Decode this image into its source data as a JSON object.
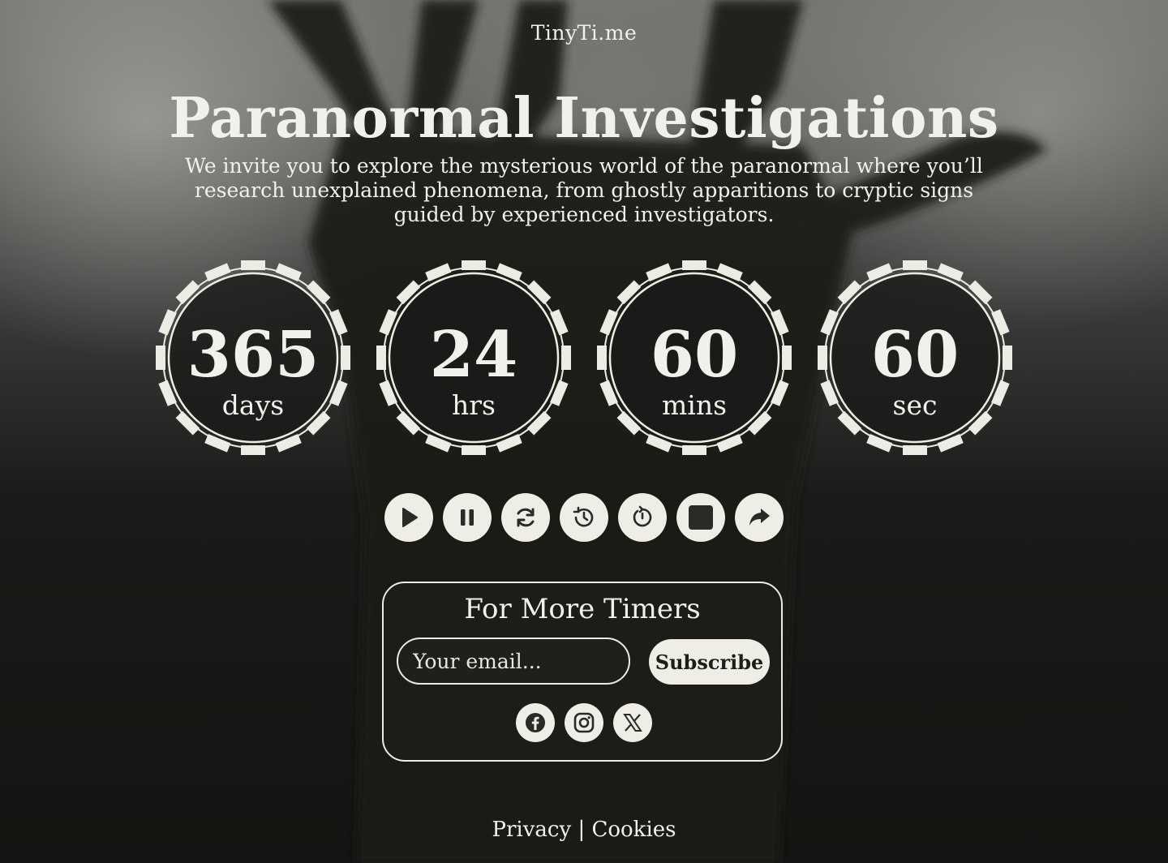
{
  "brand": "TinyTi.me",
  "title": "Paranormal Investigations",
  "subtitle": "We invite you to explore the mysterious world of the paranormal where you’ll research unexplained phenomena, from ghostly apparitions to cryptic signs guided by experienced investigators.",
  "counters": [
    {
      "value": "365",
      "unit": "days"
    },
    {
      "value": "24",
      "unit": "hrs"
    },
    {
      "value": "60",
      "unit": "mins"
    },
    {
      "value": "60",
      "unit": "sec"
    }
  ],
  "controls": [
    {
      "icon": "play-icon"
    },
    {
      "icon": "pause-icon"
    },
    {
      "icon": "refresh-icon"
    },
    {
      "icon": "history-icon"
    },
    {
      "icon": "restart-icon"
    },
    {
      "icon": "stop-icon"
    },
    {
      "icon": "share-icon"
    }
  ],
  "subscribe": {
    "title": "For More Timers",
    "email_placeholder": "Your email...",
    "button_label": "Subscribe"
  },
  "socials": [
    {
      "icon": "facebook-icon"
    },
    {
      "icon": "instagram-icon"
    },
    {
      "icon": "x-twitter-icon"
    }
  ],
  "footer": {
    "privacy": "Privacy",
    "separator": "|",
    "cookies": "Cookies"
  },
  "colors": {
    "background": "#151614",
    "foreground": "#f1f0ea",
    "button_bg": "#eeede6",
    "icon_dark": "#2a2b26"
  }
}
